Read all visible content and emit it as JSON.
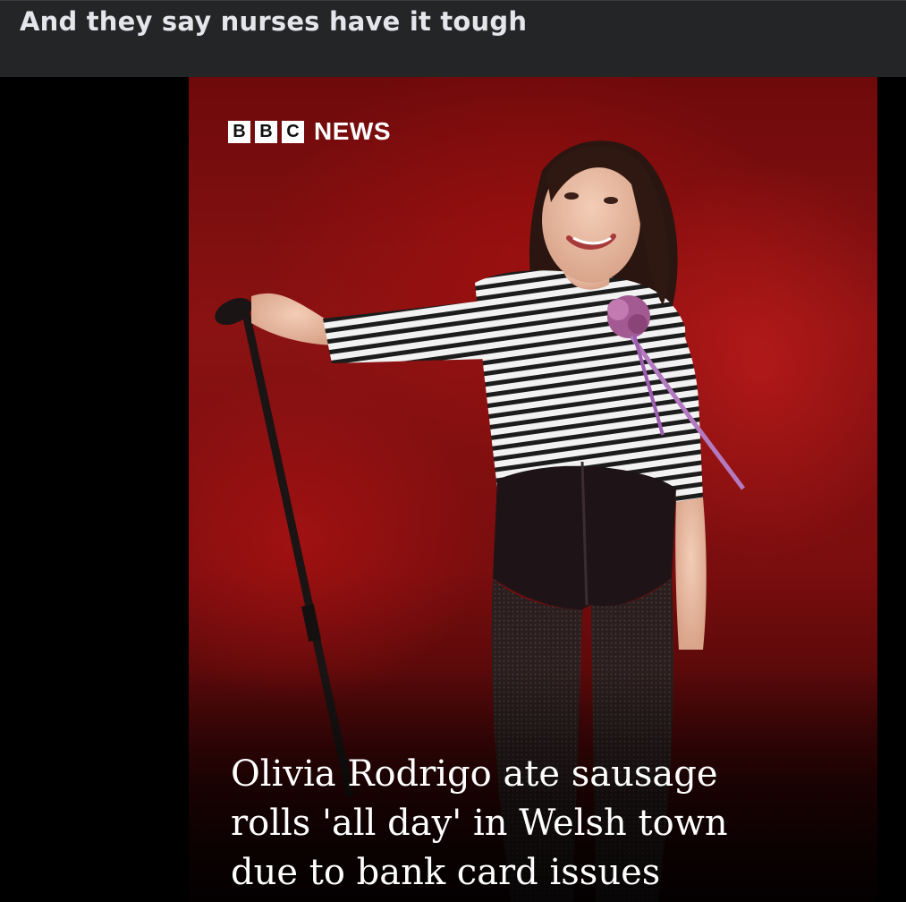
{
  "post": {
    "caption": "And they say nurses have it tough"
  },
  "news_card": {
    "logo": {
      "letters": [
        "B",
        "B",
        "C"
      ],
      "word": "NEWS"
    },
    "headline_lines": [
      "Olivia Rodrigo ate sausage",
      "rolls 'all day' in Welsh town",
      "due to bank card issues"
    ]
  },
  "colors": {
    "header_bg": "#242526",
    "caption_text": "#e4e6eb",
    "stage_red": "#8a1212",
    "headline_text": "#ffffff"
  }
}
